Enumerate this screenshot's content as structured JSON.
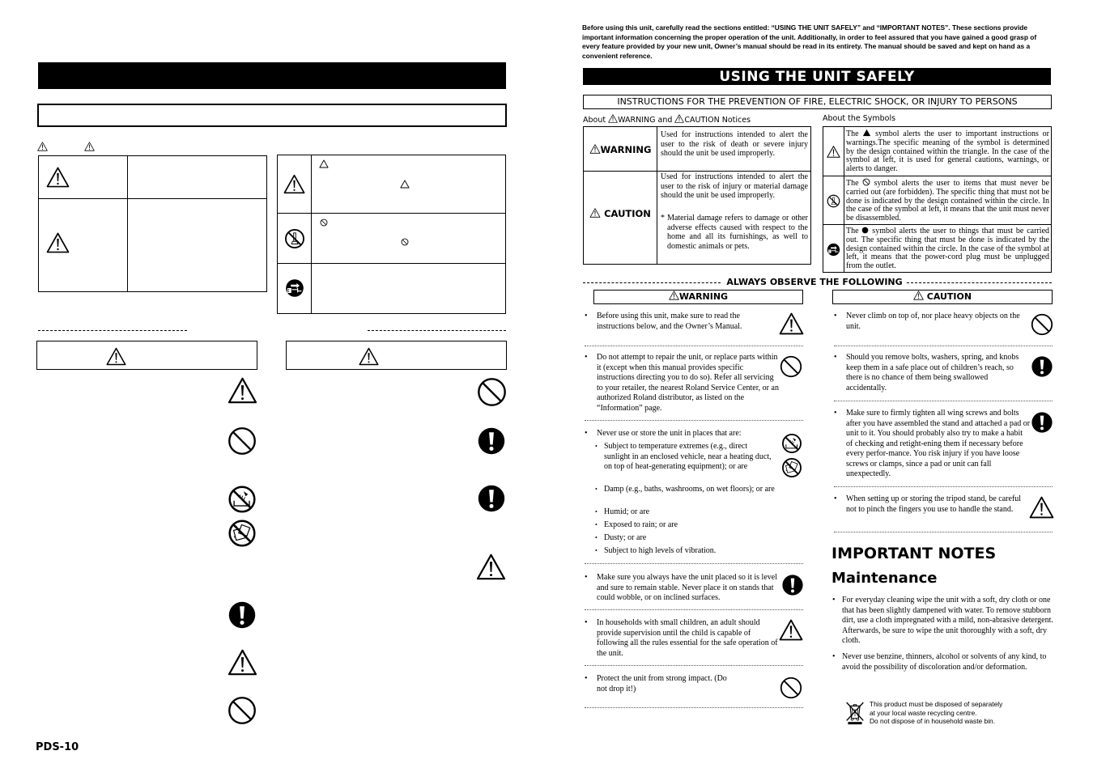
{
  "left_page": {
    "page_number": "PDS-10",
    "icons": {
      "notice_header": [
        "warning-triangle",
        "warning-triangle"
      ],
      "table1": [
        "warning-triangle",
        "warning-triangle"
      ],
      "table2": [
        "warning-triangle",
        "prohibition-disassemble",
        "unplug-power"
      ],
      "warning_column": [
        "warning-triangle",
        "prohibition",
        "prohibition-water",
        "prohibition-wet",
        "mandatory-action",
        "warning-triangle",
        "prohibition"
      ],
      "caution_column": [
        "prohibition",
        "mandatory-action",
        "mandatory-action",
        "warning-triangle"
      ]
    }
  },
  "right_page": {
    "intro": "Before using this unit, carefully read the sections entitled: “USING THE UNIT SAFELY” and “IMPORTANT NOTES”. These sections provide important information concerning the proper operation of the unit. Additionally, in order to feel assured that you have gained a good grasp of every feature provided by your new unit, Owner’s manual should be read in its entirety. The manual should be saved and kept on hand as a convenient reference.",
    "title": "USING THE UNIT SAFELY",
    "instructions_heading": "INSTRUCTIONS FOR THE PREVENTION OF FIRE, ELECTRIC SHOCK, OR INJURY TO PERSONS",
    "about_notices": {
      "prefix": "About",
      "warning": "WARNING",
      "and": "and",
      "caution": "CAUTION",
      "suffix": "Notices"
    },
    "about_symbols": "About the Symbols",
    "notice_table": [
      {
        "label": "WARNING",
        "text": "Used for instructions intended to alert the user to the risk of death or severe injury should the unit be used improperly."
      },
      {
        "label": "CAUTION",
        "text": "Used for instructions intended to alert the user to the risk of injury or material damage should the unit be used improperly.",
        "note": "* Material damage refers to damage or other adverse effects caused with respect to the home and all its furnishings, as well to domestic animals or pets."
      }
    ],
    "symbol_table": [
      {
        "icon": "warning-triangle",
        "pre": "The",
        "post": "symbol alerts the user to important instructions or warnings.The specific meaning of the symbol is determined by the design contained within the triangle. In the case of the symbol at left, it is used for general cautions, warnings, or alerts to danger."
      },
      {
        "icon": "prohibition-disassemble",
        "pre": "The",
        "post": "symbol alerts the user to items that must never be carried out (are forbidden). The specific thing that must not be done is indicated by the design contained within the circle. In the case of the symbol at left, it means that the unit must never be disassembled."
      },
      {
        "icon": "unplug-power",
        "pre": "The",
        "post": "symbol alerts the user to things that must be carried out. The specific thing that must be done is indicated by the design contained within the circle. In the case of the symbol at left, it means that the power-cord plug must be unplugged from the outlet."
      }
    ],
    "always_observe": "ALWAYS OBSERVE THE FOLLOWING",
    "warning_heading": "WARNING",
    "caution_heading": "CAUTION",
    "warning_items": [
      {
        "text": "Before using this unit, make sure to read the instructions below, and the Owner’s Manual.",
        "icon": "warning-triangle"
      },
      {
        "text": "Do not attempt to repair the unit, or replace parts within it (except when this manual provides specific instructions directing you to do so). Refer all servicing to your retailer, the nearest Roland Service Center, or an authorized Roland distributor, as listed on the “Information” page.",
        "icon": "prohibition"
      },
      {
        "text": "Never use or store the unit in places that are:",
        "icon": "prohibition-water",
        "subitems": [
          "Subject to temperature extremes (e.g., direct sunlight in an enclosed vehicle, near a heating duct, on top of heat-generating equipment); or are",
          "Damp (e.g., baths, washrooms, on wet floors); or are",
          "Humid; or are",
          "Exposed to rain; or are",
          "Dusty; or are",
          "Subject to high levels of vibration."
        ]
      },
      {
        "text": "Make sure you always have the unit placed so it is level and sure to remain stable. Never place it on stands that could wobble, or on inclined surfaces.",
        "icon": "mandatory-action"
      },
      {
        "text": "In households with small children, an adult should provide supervision until the child is capable of following all the rules essential for the safe operation of the unit.",
        "icon": "warning-triangle"
      },
      {
        "text": "Protect the unit from strong impact. (Do not drop it!)",
        "icon": "prohibition"
      }
    ],
    "caution_items": [
      {
        "text": "Never climb on top of, nor place heavy objects on the unit.",
        "icon": "prohibition"
      },
      {
        "text": "Should you remove bolts, washers, spring, and knobs keep them in a safe place out of children’s reach, so there is no chance of them being swallowed accidentally.",
        "icon": "mandatory-action"
      },
      {
        "text": "Make sure to firmly tighten all wing screws and bolts after you have assembled the stand and attached a pad or unit to it. You should probably also try to make a habit of checking and retight-ening them if necessary before every perfor-mance. You risk injury if you have loose screws or clamps, since a pad or unit can fall unexpectedly.",
        "icon": "mandatory-action"
      },
      {
        "text": "When setting up or storing the tripod stand, be careful not to pinch the fingers you use to handle the stand.",
        "icon": "warning-triangle"
      }
    ],
    "important_notes_title": "IMPORTANT NOTES",
    "maintenance_title": "Maintenance",
    "maintenance_items": [
      "For everyday cleaning wipe the unit with a soft, dry cloth or one that has been slightly dampened with water. To remove stubborn dirt, use a cloth impregnated with a mild, non-abrasive detergent. Afterwards, be sure to wipe the unit thoroughly with a soft, dry cloth.",
      "Never use benzine, thinners, alcohol or solvents of any kind, to avoid the possibility of discoloration and/or deformation."
    ],
    "disposal_notice": [
      "This product must be disposed of separately",
      "at your local waste recycling centre.",
      "Do not dispose of in household waste bin."
    ]
  }
}
